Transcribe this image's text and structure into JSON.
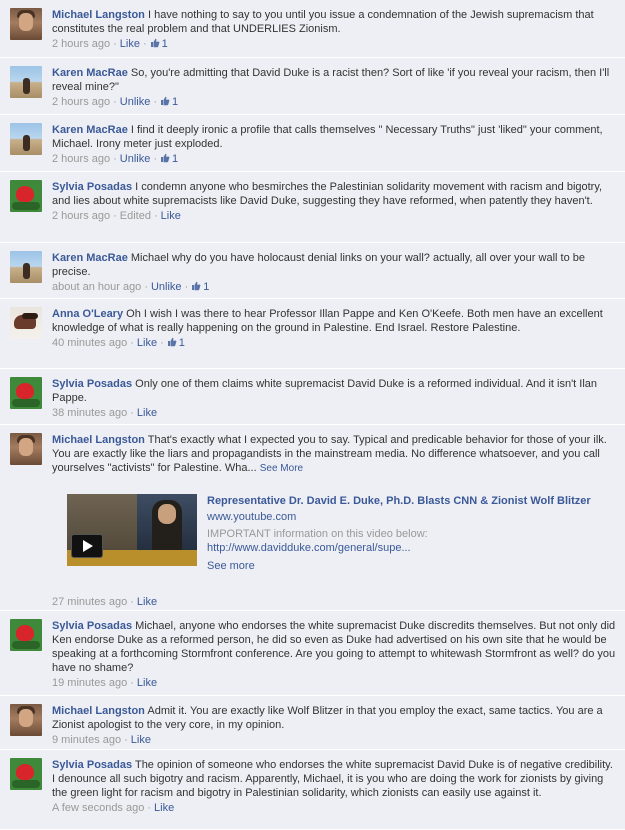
{
  "actions": {
    "like": "Like",
    "unlike": "Unlike",
    "see_more": "See More",
    "edited": "Edited",
    "separator": "·"
  },
  "comments": [
    {
      "id": "c1",
      "avatar": "michael-langston-avatar",
      "author": "Michael Langston",
      "text": "I have nothing to say to you until you issue a condemnation of the Jewish supremacism that constitutes the real problem and that UNDERLIES Zionism.",
      "time": "2 hours ago",
      "action": "Like",
      "likes": "1"
    },
    {
      "id": "c2",
      "avatar": "karen-macrae-avatar",
      "author": "Karen MacRae",
      "text": "So, you're admitting that David Duke is a racist then? Sort of like 'if you reveal your racism, then I'll reveal mine?\"",
      "time": "2 hours ago",
      "action": "Unlike",
      "likes": "1"
    },
    {
      "id": "c3",
      "avatar": "karen-macrae-avatar",
      "author": "Karen MacRae",
      "text": "I find it deeply ironic a profile that calls themselves \" Necessary Truths\" just 'liked\" your comment, Michael. Irony meter just exploded.",
      "time": "2 hours ago",
      "action": "Unlike",
      "likes": "1"
    },
    {
      "id": "c4",
      "avatar": "sylvia-posadas-avatar",
      "author": "Sylvia Posadas",
      "text": "I condemn anyone who besmirches the Palestinian solidarity movement with racism and bigotry, and lies about white supremacists like David Duke, suggesting they have reformed, when patently they haven't.",
      "time": "2 hours ago",
      "edited": "Edited",
      "action": "Like"
    },
    {
      "id": "c5",
      "avatar": "karen-macrae-avatar",
      "author": "Karen MacRae",
      "text": "Michael why do you have holocaust denial links on your wall? actually, all over your wall to be precise.",
      "time": "about an hour ago",
      "action": "Unlike",
      "likes": "1"
    },
    {
      "id": "c6",
      "avatar": "anna-oleary-avatar",
      "author": "Anna O'Leary",
      "text": "Oh I wish I was there to hear Professor Illan Pappe and Ken O'Keefe. Both men have an excellent knowledge of what is really happening on the ground in Palestine. End Israel. Restore Palestine.",
      "time": "40 minutes ago",
      "action": "Like",
      "likes": "1"
    },
    {
      "id": "c7",
      "avatar": "sylvia-posadas-avatar",
      "author": "Sylvia Posadas",
      "text": "Only one of them claims white supremacist David Duke is a reformed individual. And it isn't Ilan Pappe.",
      "time": "38 minutes ago",
      "action": "Like"
    },
    {
      "id": "c8",
      "avatar": "michael-langston-avatar",
      "author": "Michael Langston",
      "text": "That's exactly what I expected you to say. Typical and predicable behavior for those of your ilk. You are exactly like the liars and propagandists in the mainstream media. No difference whatsoever, and you call yourselves \"activists\" for Palestine. Wha...",
      "see_more": "See More",
      "time": "27 minutes ago",
      "action": "Like",
      "attachment": {
        "title": "Representative Dr. David E. Duke, Ph.D. Blasts CNN & Zionist Wolf Blitzer",
        "url": "www.youtube.com",
        "desc": "IMPORTANT information on this video below:",
        "desc_link": "http://www.davidduke.com/general/supe...",
        "see_more": "See more"
      }
    },
    {
      "id": "c9",
      "avatar": "sylvia-posadas-avatar",
      "author": "Sylvia Posadas",
      "text": "Michael, anyone who endorses the white supremacist Duke discredits themselves. But not only did Ken endorse Duke as a reformed person, he did so even as Duke had advertised on his own site that he would be speaking at a forthcoming Stormfront conference. Are you going to attempt to whitewash Stormfront as well? do you have no shame?",
      "time": "19 minutes ago",
      "action": "Like"
    },
    {
      "id": "c10",
      "avatar": "michael-langston-avatar",
      "author": "Michael Langston",
      "text": "Admit it. You are exactly like Wolf Blitzer in that you employ the exact, same tactics. You are a Zionist apologist to the very core, in my opinion.",
      "time": "9 minutes ago",
      "action": "Like"
    },
    {
      "id": "c11",
      "avatar": "sylvia-posadas-avatar",
      "author": "Sylvia Posadas",
      "text": "The opinion of someone who endorses the white supremacist David Duke is of negative credibility. I denounce all such bigotry and racism. Apparently, Michael, it is you who are doing the work for zionists by giving the green light for racism and bigotry in Palestinian solidarity, which zionists can easily use against it.",
      "time": "A few seconds ago",
      "action": "Like"
    }
  ]
}
